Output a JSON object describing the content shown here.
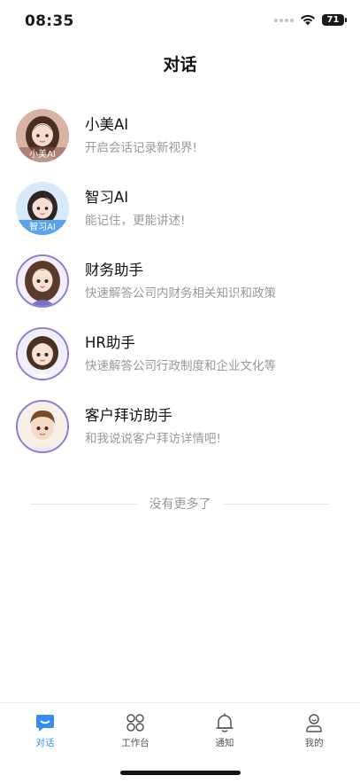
{
  "status": {
    "time": "08:35",
    "battery": "71"
  },
  "page_title": "对话",
  "chats": [
    {
      "name": "小美AI",
      "desc": "开启会话记录新视界!",
      "badge": "小美AI"
    },
    {
      "name": "智习AI",
      "desc": "能记住，更能讲述!",
      "badge": "智习AI"
    },
    {
      "name": "财务助手",
      "desc": "快速解答公司内财务相关知识和政策"
    },
    {
      "name": "HR助手",
      "desc": "快速解答公司行政制度和企业文化等"
    },
    {
      "name": "客户拜访助手",
      "desc": "和我说说客户拜访详情吧!"
    }
  ],
  "list_footer": "没有更多了",
  "tabs": [
    {
      "label": "对话",
      "icon": "chat-bubble-icon",
      "active": true
    },
    {
      "label": "工作台",
      "icon": "grid-icon",
      "active": false
    },
    {
      "label": "通知",
      "icon": "bell-icon",
      "active": false
    },
    {
      "label": "我的",
      "icon": "user-icon",
      "active": false
    }
  ],
  "colors": {
    "accent": "#3a8cf5",
    "muted_text": "#999999"
  }
}
